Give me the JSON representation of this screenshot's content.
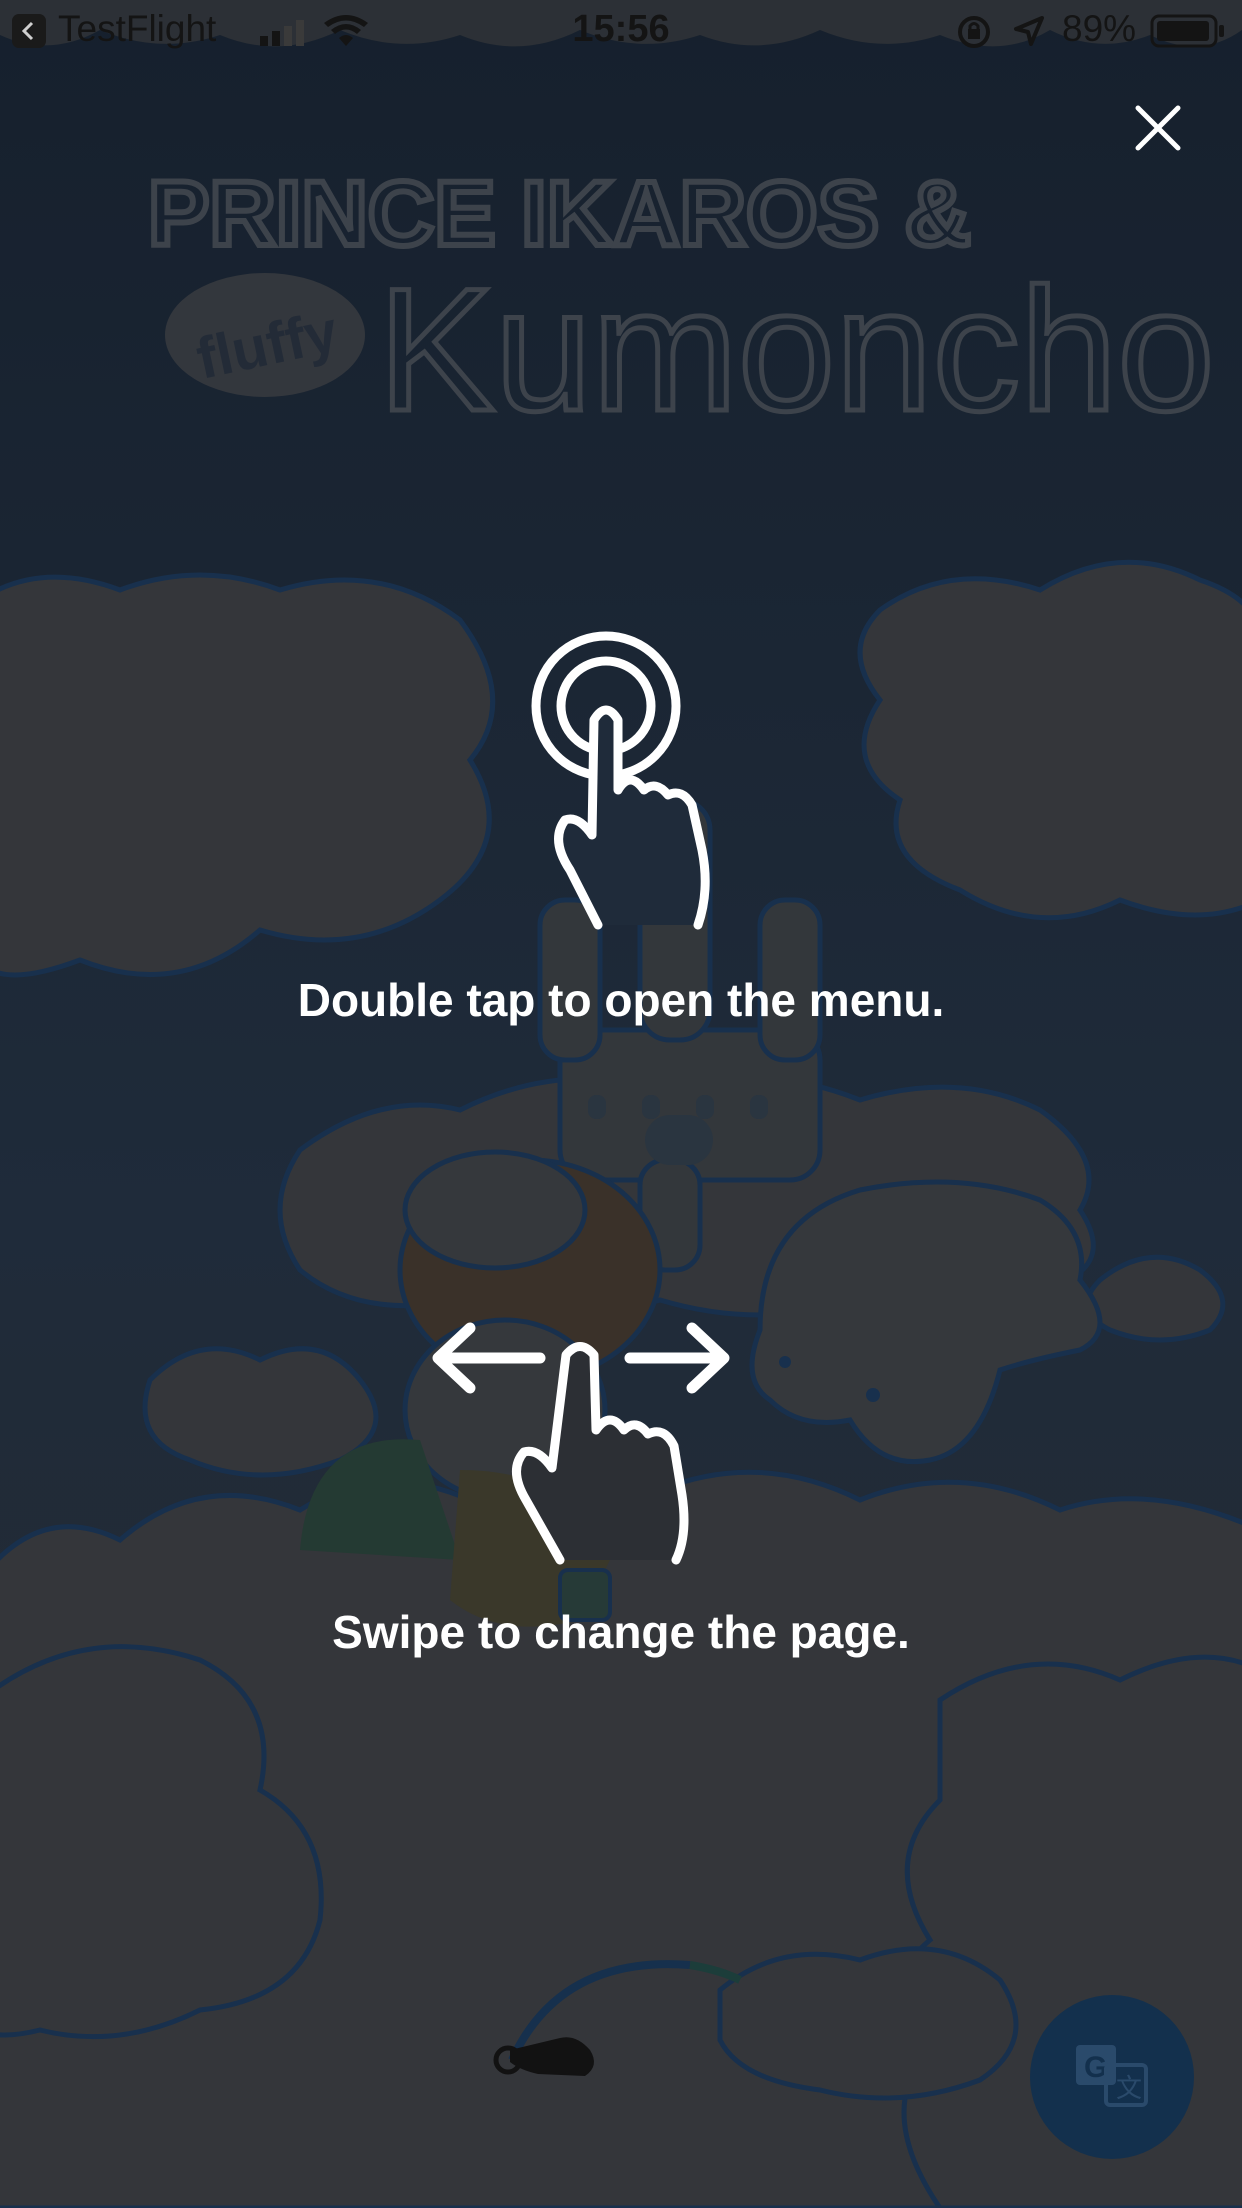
{
  "status_bar": {
    "back_app": "TestFlight",
    "time": "15:56",
    "battery_percent": "89%"
  },
  "hints": {
    "double_tap": "Double tap to open the menu.",
    "swipe": "Swipe to change the page."
  },
  "background": {
    "title_line1": "PRINCE IKAROS &",
    "title_small": "fluffy",
    "title_big": "Kumoncho"
  },
  "colors": {
    "overlay": "#1b2230",
    "hint_text": "#ffffff",
    "translate_button": "#13304d"
  },
  "icons": {
    "close": "close-icon",
    "double_tap": "double-tap-gesture-icon",
    "swipe": "swipe-gesture-icon",
    "translate": "translate-icon"
  }
}
